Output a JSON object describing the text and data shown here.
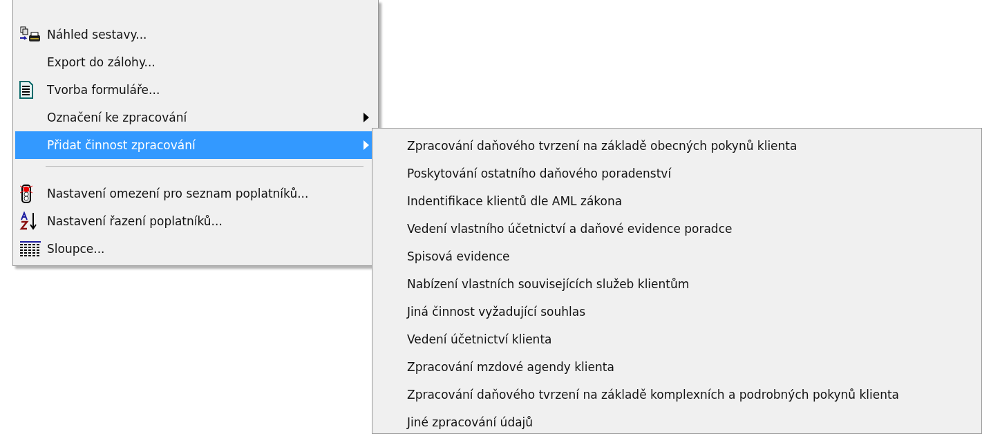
{
  "menu": {
    "items": [
      {
        "kind": "item",
        "label": "Náhled sestavy...",
        "has_submenu": false,
        "selected": false
      },
      {
        "kind": "item",
        "label": "Export do zálohy...",
        "has_submenu": false,
        "selected": false
      },
      {
        "kind": "item",
        "label": "Tvorba formuláře...",
        "has_submenu": false,
        "selected": false
      },
      {
        "kind": "item",
        "label": "Označení ke zpracování",
        "has_submenu": true,
        "selected": false
      },
      {
        "kind": "item",
        "label": "Přidat činnost zpracování",
        "has_submenu": true,
        "selected": true
      },
      {
        "kind": "separator"
      },
      {
        "kind": "item",
        "label": "Nastavení omezení pro seznam poplatníků...",
        "has_submenu": false,
        "selected": false
      },
      {
        "kind": "item",
        "label": "Nastavení řazení poplatníků...",
        "has_submenu": false,
        "selected": false
      },
      {
        "kind": "item",
        "label": "Sloupce...",
        "has_submenu": false,
        "selected": false
      }
    ]
  },
  "submenu": {
    "items": [
      "Zpracování daňového tvrzení na základě obecných pokynů klienta",
      "Poskytování ostatního daňového poradenství",
      "Indentifikace klientů dle AML zákona",
      "Vedení vlastního účetnictví a daňové evidence poradce",
      "Spisová evidence",
      "Nabízení vlastních souvisejících služeb klientům",
      "Jiná činnost vyžadující souhlas",
      "Vedení účetnictví klienta",
      "Zpracování mzdové agendy klienta",
      "Zpracování daňového tvrzení na základě komplexních a podrobných pokynů klienta",
      "Jiné zpracování údajů"
    ]
  }
}
